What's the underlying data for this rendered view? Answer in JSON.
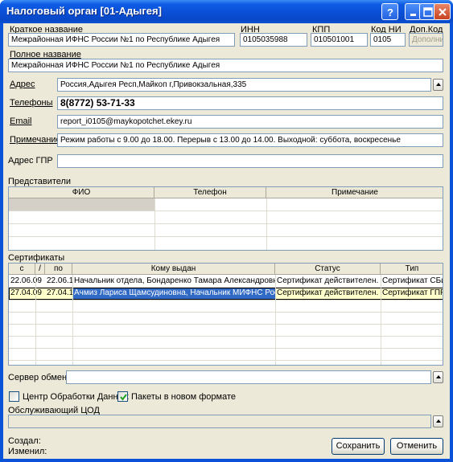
{
  "window": {
    "title": "Налоговый орган [01-Адыгея]"
  },
  "fields": {
    "short_name_label": "Краткое название",
    "short_name_value": "Межрайонная ИФНС России №1 по Республике Адыгея",
    "inn_label": "ИНН",
    "inn_value": "0105035988",
    "kpp_label": "КПП",
    "kpp_value": "010501001",
    "code_ni_label": "Код НИ",
    "code_ni_value": "0105",
    "dop_code_label": "Доп.Код",
    "dop_code_placeholder": "Дополни",
    "full_name_label": "Полное название",
    "full_name_value": "Межрайонная ИФНС России №1 по Республике Адыгея",
    "address_label": "Адрес",
    "address_value": "Россия,Адыгея Респ,Майкоп г,Привокзальная,335",
    "phones_label": "Телефоны",
    "phones_value": "8(8772) 53-71-33",
    "email_label": "Email",
    "email_value": "report_i0105@maykopotchet.ekey.ru",
    "note_label": "Примечание",
    "note_value": "Режим работы с 9.00 до 18.00. Перерыв с 13.00 до 14.00. Выходной: суббота, воскресенье",
    "gpr_address_label": "Адрес ГПР",
    "gpr_address_value": ""
  },
  "representatives": {
    "label": "Представители",
    "columns": [
      "ФИО",
      "Телефон",
      "Примечание"
    ]
  },
  "certificates": {
    "label": "Сертификаты",
    "columns": [
      "с",
      "/",
      "по",
      "Кому выдан",
      "Статус",
      "Тип"
    ],
    "rows": [
      {
        "from": "22.06.09",
        "to": "22.06.10",
        "issued_to": "Начальник отдела, Бондаренко Тамара Александровна, Ме",
        "status": "Сертификат действителен.",
        "type": "Сертификат СБиС"
      },
      {
        "from": "27.04.09",
        "to": "27.04.10",
        "issued_to": "Ачмиз Лариса Щамсудиновна, Начальник МИФНС России",
        "status": "Сертификат действителен.",
        "type": "Сертификат ГПР"
      }
    ]
  },
  "exchange_server": {
    "label": "Сервер обмена",
    "value": ""
  },
  "options": {
    "data_center_label": "Центр Обработки Данных",
    "data_center_checked": false,
    "new_format_label": "Пакеты в новом формате",
    "new_format_checked": true
  },
  "serving_cod": {
    "label": "Обслуживающий ЦОД",
    "value": ""
  },
  "footer": {
    "created_label": "Создал:",
    "modified_label": "Изменил:",
    "save_label": "Сохранить",
    "cancel_label": "Отменить"
  },
  "colors": {
    "titlebar": "#0a4fd6",
    "dialog_bg": "#ece9d8",
    "selection": "#316ac5",
    "selected_row": "#ffffcc"
  }
}
